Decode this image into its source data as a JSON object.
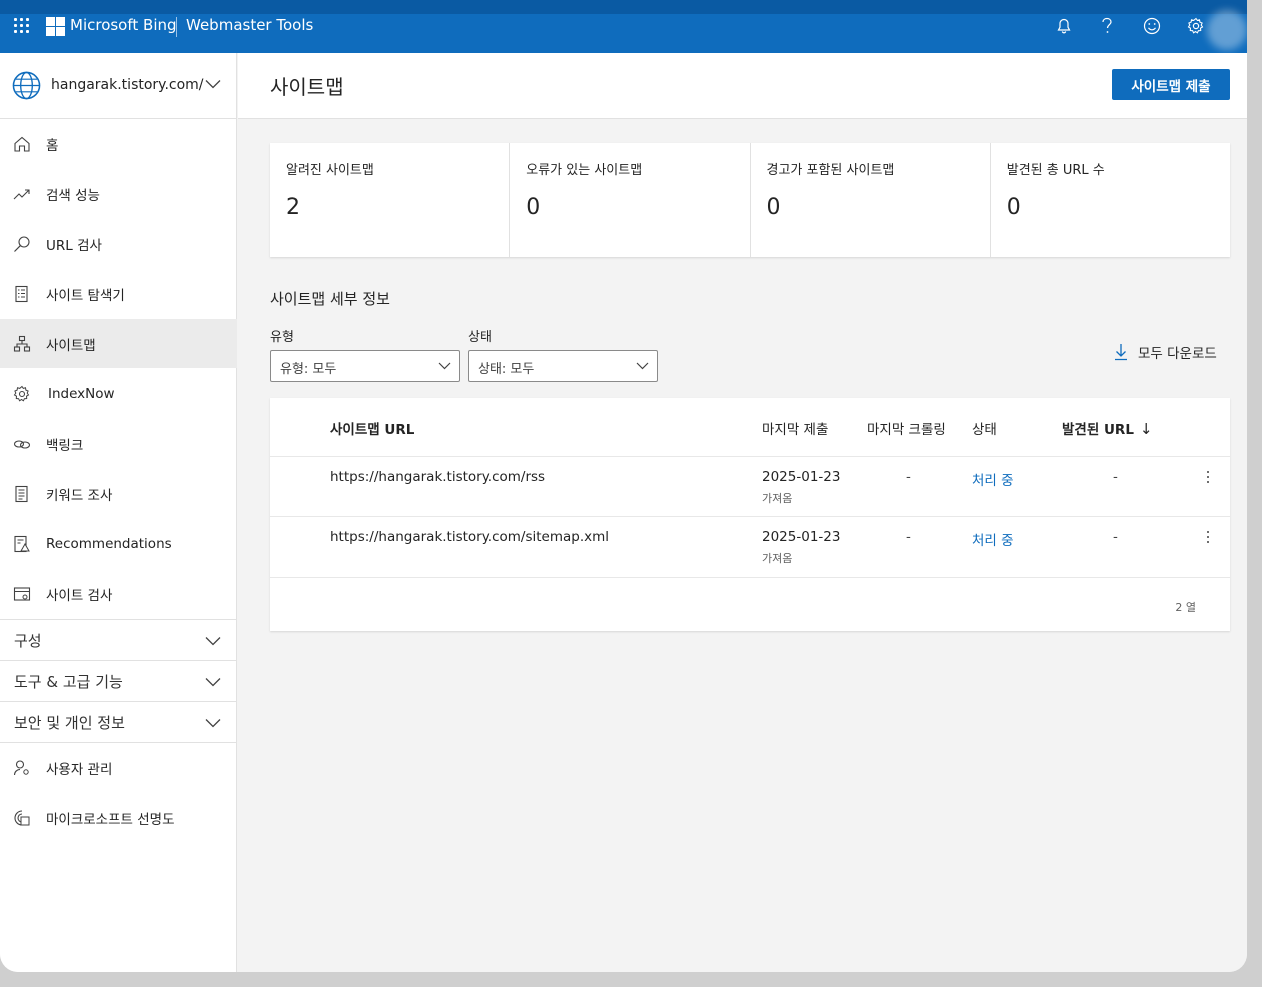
{
  "topbar": {
    "brand": "Microsoft Bing",
    "product": "Webmaster Tools",
    "icons": [
      "bell-icon",
      "help-icon",
      "feedback-smiley-icon",
      "settings-gear-icon"
    ]
  },
  "sidebar": {
    "site": "hangarak.tistory.com/",
    "items": [
      {
        "label": "홈",
        "icon": "home-icon"
      },
      {
        "label": "검색 성능",
        "icon": "trend-icon"
      },
      {
        "label": "URL 검사",
        "icon": "search-icon"
      },
      {
        "label": "사이트 탐색기",
        "icon": "list-icon"
      },
      {
        "label": "사이트맵",
        "icon": "sitemap-icon",
        "active": true
      },
      {
        "label": "IndexNow",
        "icon": "gear-icon"
      },
      {
        "label": "백링크",
        "icon": "link-icon"
      },
      {
        "label": "키워드 조사",
        "icon": "document-icon"
      },
      {
        "label": "Recommendations",
        "icon": "recommendations-icon"
      },
      {
        "label": "사이트 검사",
        "icon": "site-scan-icon"
      }
    ],
    "groups": [
      {
        "label": "구성"
      },
      {
        "label": "도구 & 고급 기능"
      },
      {
        "label": "보안 및 개인 정보"
      }
    ],
    "bottom_items": [
      {
        "label": "사용자 관리",
        "icon": "user-settings-icon"
      },
      {
        "label": "마이크로소프트 선명도",
        "icon": "clarity-icon"
      }
    ]
  },
  "page": {
    "title": "사이트맵",
    "submit_label": "사이트맵 제출"
  },
  "stats": [
    {
      "label": "알려진 사이트맵",
      "value": "2"
    },
    {
      "label": "오류가 있는 사이트맵",
      "value": "0"
    },
    {
      "label": "경고가 포함된 사이트맵",
      "value": "0"
    },
    {
      "label": "발견된 총 URL 수",
      "value": "0"
    }
  ],
  "details": {
    "title": "사이트맵 세부 정보",
    "type_label": "유형",
    "type_value": "유형: 모두",
    "status_label": "상태",
    "status_value": "상태: 모두",
    "download_label": "모두 다운로드"
  },
  "table": {
    "headers": {
      "url": "사이트맵 URL",
      "last_submit": "마지막 제출",
      "last_crawl": "마지막 크롤링",
      "status": "상태",
      "found_urls": "발견된 URL"
    },
    "rows": [
      {
        "url": "https://hangarak.tistory.com/rss",
        "date": "2025-01-23",
        "sub": "가져옴",
        "crawl": "-",
        "status": "처리 중",
        "found": "-"
      },
      {
        "url": "https://hangarak.tistory.com/sitemap.xml",
        "date": "2025-01-23",
        "sub": "가져옴",
        "crawl": "-",
        "status": "처리 중",
        "found": "-"
      }
    ],
    "footer": "2 열"
  }
}
